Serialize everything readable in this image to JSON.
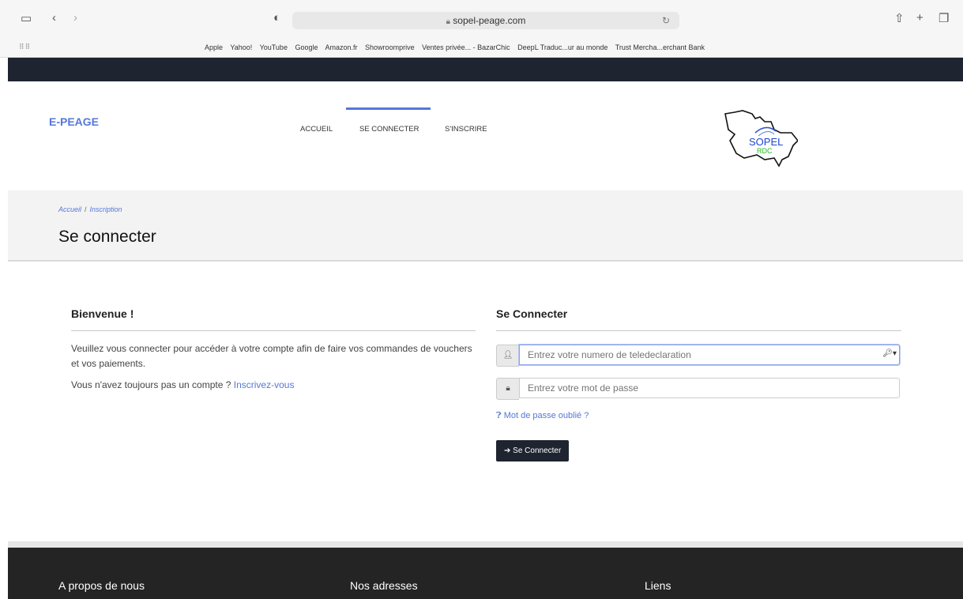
{
  "browser": {
    "url": "sopel-peage.com",
    "bookmarks": [
      "Apple",
      "Yahoo!",
      "YouTube",
      "Google",
      "Amazon.fr",
      "Showroomprive",
      "Ventes privée... - BazarChic",
      "DeepL Traduc...ur au monde",
      "Trust Mercha...erchant Bank"
    ]
  },
  "header": {
    "brand": "E-PEAGE",
    "nav": [
      "ACCUEIL",
      "SE CONNECTER",
      "S'INSCRIRE"
    ],
    "logo_text": "SOPEL",
    "logo_sub": "RDC"
  },
  "breadcrumb": {
    "home": "Accueil",
    "sep": "/",
    "current": "Inscription"
  },
  "page_title": "Se connecter",
  "welcome": {
    "heading": "Bienvenue !",
    "text": "Veuillez vous connecter pour accéder à votre compte afin de faire vos commandes de vouchers et vos paiements.",
    "no_account": "Vous n'avez toujours pas un compte ?",
    "signup_link": "Inscrivez-vous"
  },
  "login": {
    "heading": "Se Connecter",
    "tele_placeholder": "Entrez votre numero de teledeclaration",
    "password_placeholder": "Entrez votre mot de passe",
    "forgot": "Mot de passe oublié ?",
    "submit": "Se Connecter"
  },
  "footer": {
    "about": "A propos de nous",
    "addresses": "Nos adresses",
    "links": "Liens"
  }
}
